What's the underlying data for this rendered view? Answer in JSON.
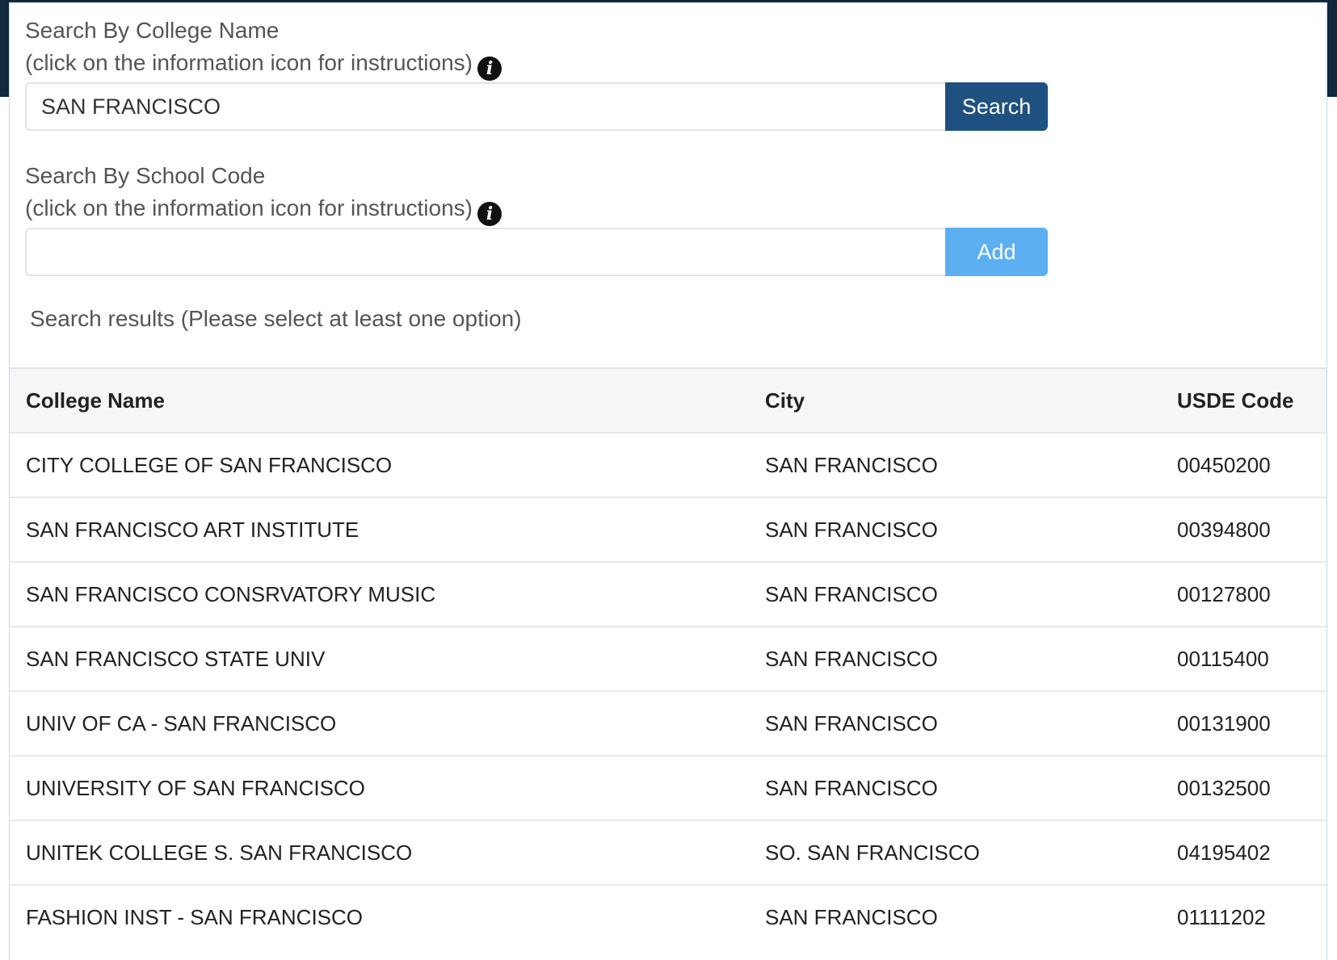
{
  "college_search": {
    "label": "Search By College Name",
    "instructions": "(click on the information icon for instructions)",
    "info_icon": "info-circle-icon",
    "value": "SAN FRANCISCO",
    "button_label": "Search"
  },
  "code_search": {
    "label": "Search By School Code",
    "instructions": "(click on the information icon for instructions)",
    "info_icon": "info-circle-icon",
    "value": "",
    "button_label": "Add"
  },
  "results": {
    "label": "Search results (Please select at least one option)",
    "columns": [
      "College Name",
      "City",
      "USDE Code"
    ],
    "rows": [
      {
        "name": "CITY COLLEGE OF SAN FRANCISCO",
        "city": "SAN FRANCISCO",
        "code": "00450200"
      },
      {
        "name": "SAN FRANCISCO ART INSTITUTE",
        "city": "SAN FRANCISCO",
        "code": "00394800"
      },
      {
        "name": "SAN FRANCISCO CONSRVATORY MUSIC",
        "city": "SAN FRANCISCO",
        "code": "00127800"
      },
      {
        "name": "SAN FRANCISCO STATE UNIV",
        "city": "SAN FRANCISCO",
        "code": "00115400"
      },
      {
        "name": "UNIV OF CA - SAN FRANCISCO",
        "city": "SAN FRANCISCO",
        "code": "00131900"
      },
      {
        "name": "UNIVERSITY OF SAN FRANCISCO",
        "city": "SAN FRANCISCO",
        "code": "00132500"
      },
      {
        "name": "UNITEK COLLEGE S. SAN FRANCISCO",
        "city": "SO. SAN FRANCISCO",
        "code": "04195402"
      },
      {
        "name": "FASHION INST - SAN FRANCISCO",
        "city": "SAN FRANCISCO",
        "code": "01111202"
      }
    ]
  },
  "colors": {
    "search_button": "#1f5180",
    "add_button": "#5caff1",
    "backdrop": "#10293d"
  }
}
